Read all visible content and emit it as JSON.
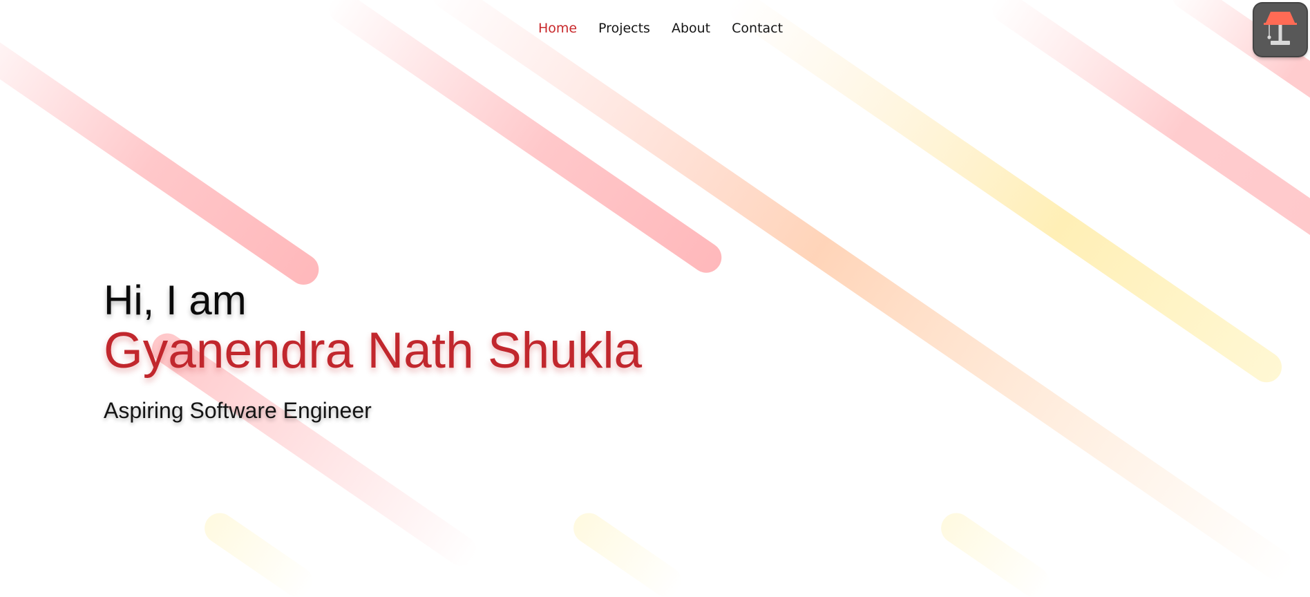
{
  "nav": {
    "items": [
      {
        "label": "Home",
        "active": true
      },
      {
        "label": "Projects",
        "active": false
      },
      {
        "label": "About",
        "active": false
      },
      {
        "label": "Contact",
        "active": false
      }
    ]
  },
  "theme_toggle": {
    "icon": "lamp-icon"
  },
  "hero": {
    "greeting": "Hi, I am",
    "name": "Gyanendra Nath Shukla",
    "role": "Aspiring Software Engineer"
  },
  "colors": {
    "accent": "#c1272d",
    "text": "#0a0a0a",
    "background": "#ffffff",
    "stripe_red": "#ff9a9e",
    "stripe_orange": "#ffb88a",
    "stripe_yellow": "#ffe27a"
  }
}
